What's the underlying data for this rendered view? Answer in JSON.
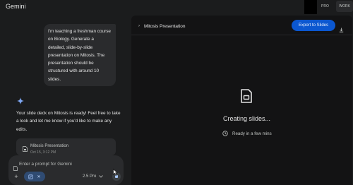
{
  "app": {
    "title": "Gemini",
    "badges": {
      "pro": "PRO",
      "work": "WORK"
    }
  },
  "chat": {
    "user_message": "I'm teaching a freshman course on Biology. Generate a detailed, slide-by-slide presentation on Mitosis. The presentation should be structured with around 10 slides.",
    "assistant_message": "Your slide deck on Mitosis is ready! Feel free to take a look and let me know if you'd like to make any edits.",
    "attachment": {
      "title": "Mitosis Presentation",
      "date": "Oct 15, 3:12 PM"
    }
  },
  "input": {
    "placeholder": "Enter a prompt for Gemini",
    "model": "2.5 Pro"
  },
  "canvas": {
    "title": "Mitosis Presentation",
    "export_label": "Export to Slides",
    "status": "Creating slides...",
    "eta": "Ready in a few mins"
  },
  "icons": {
    "spark": "gemini-spark-icon",
    "file": "slides-file-icon",
    "add": "plus-icon",
    "tool": "slides-tool-icon",
    "stop": "stop-icon",
    "download": "download-icon",
    "clock": "clock-icon"
  },
  "colors": {
    "background": "#1b1c1d",
    "canvas": "#131314",
    "accent": "#0b57d0",
    "bubble": "#2a2b2d"
  }
}
